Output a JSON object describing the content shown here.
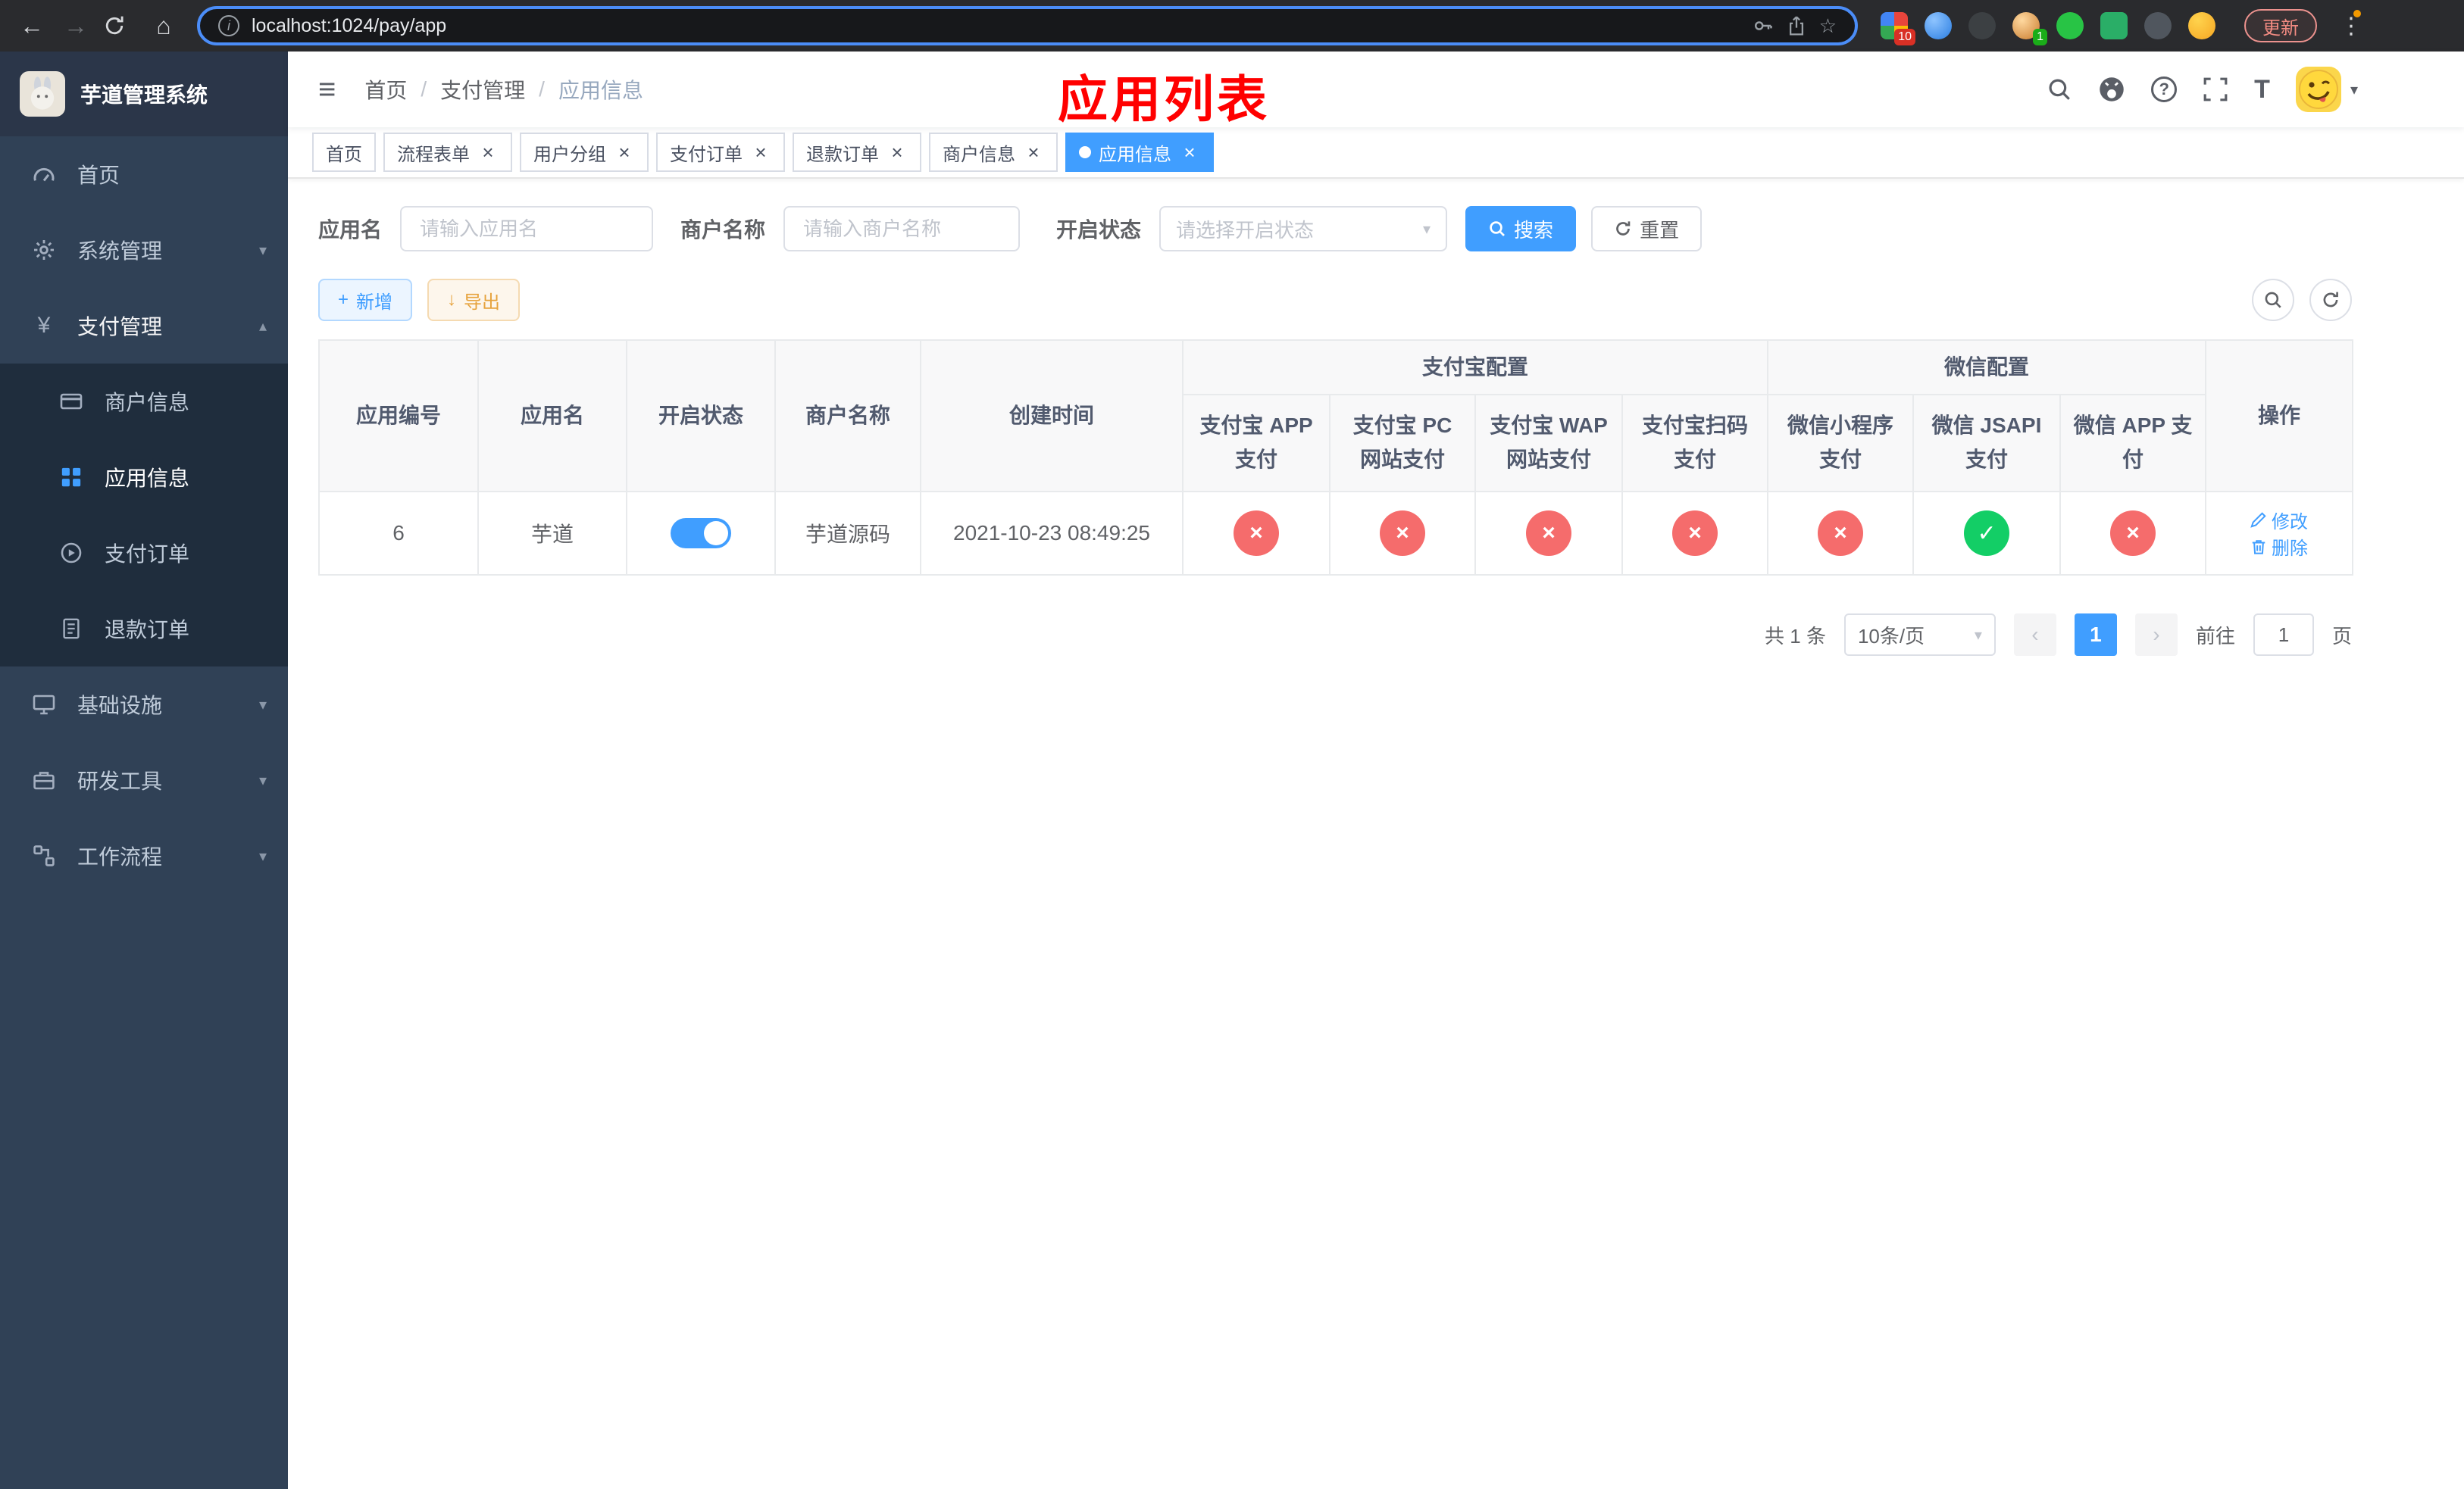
{
  "icons": {
    "back": "←",
    "forward": "→",
    "home": "⌂",
    "star": "☆",
    "dots": "⋮",
    "close": "×",
    "check": "✓",
    "cross": "×",
    "plus": "+",
    "download_arrow": "↓",
    "caret_down": "▾",
    "caret_up": "▴",
    "yen": "¥",
    "hamburger": "≡",
    "question": "?",
    "font_size": "T",
    "info": "i",
    "prev": "‹",
    "next": "›"
  },
  "colors": {
    "primary": "#409eff",
    "danger": "#f56c6c",
    "success": "#13ce66",
    "annotation": "#ff0000",
    "sidebar_bg": "#304156",
    "submenu_bg": "#1f2d3d"
  },
  "browser": {
    "url": "localhost:1024/pay/app",
    "update_button": "更新",
    "extension_badge_grid": "10",
    "extension_badge_avatar": "1"
  },
  "sidebar": {
    "app_title": "芋道管理系统",
    "items": [
      {
        "label": "首页"
      },
      {
        "label": "系统管理"
      },
      {
        "label": "支付管理",
        "children": [
          {
            "label": "商户信息"
          },
          {
            "label": "应用信息"
          },
          {
            "label": "支付订单"
          },
          {
            "label": "退款订单"
          }
        ]
      },
      {
        "label": "基础设施"
      },
      {
        "label": "研发工具"
      },
      {
        "label": "工作流程"
      }
    ]
  },
  "header": {
    "breadcrumb": [
      "首页",
      "支付管理",
      "应用信息"
    ],
    "breadcrumb_separator": "/",
    "annotation": "应用列表"
  },
  "tabs": [
    {
      "label": "首页",
      "closable": false,
      "active": false
    },
    {
      "label": "流程表单",
      "closable": true,
      "active": false
    },
    {
      "label": "用户分组",
      "closable": true,
      "active": false
    },
    {
      "label": "支付订单",
      "closable": true,
      "active": false
    },
    {
      "label": "退款订单",
      "closable": true,
      "active": false
    },
    {
      "label": "商户信息",
      "closable": true,
      "active": false
    },
    {
      "label": "应用信息",
      "closable": true,
      "active": true
    }
  ],
  "filters": {
    "app_name_label": "应用名",
    "app_name_placeholder": "请输入应用名",
    "merchant_label": "商户名称",
    "merchant_placeholder": "请输入商户名称",
    "status_label": "开启状态",
    "status_placeholder": "请选择开启状态",
    "search_button": "搜索",
    "reset_button": "重置"
  },
  "toolbar": {
    "add_button": "新增",
    "export_button": "导出"
  },
  "table": {
    "columns": {
      "app_id": "应用编号",
      "app_name": "应用名",
      "status": "开启状态",
      "merchant": "商户名称",
      "created": "创建时间",
      "alipay_group": "支付宝配置",
      "wechat_group": "微信配置",
      "actions": "操作",
      "alipay_app": "支付宝 APP 支付",
      "alipay_pc": "支付宝 PC 网站支付",
      "alipay_wap": "支付宝 WAP 网站支付",
      "alipay_qr": "支付宝扫码支付",
      "wechat_mini": "微信小程序支付",
      "wechat_jsapi": "微信 JSAPI 支付",
      "wechat_app": "微信 APP 支付"
    },
    "rows": [
      {
        "app_id": "6",
        "app_name": "芋道",
        "status_on": true,
        "merchant": "芋道源码",
        "created": "2021-10-23 08:49:25",
        "configs": {
          "alipay_app": false,
          "alipay_pc": false,
          "alipay_wap": false,
          "alipay_qr": false,
          "wechat_mini": false,
          "wechat_jsapi": true,
          "wechat_app": false
        },
        "edit_button": "修改",
        "delete_button": "删除"
      }
    ]
  },
  "pagination": {
    "total_text": "共 1 条",
    "page_size": "10条/页",
    "current_page": "1",
    "jump_prefix": "前往",
    "jump_value": "1",
    "jump_suffix": "页"
  }
}
